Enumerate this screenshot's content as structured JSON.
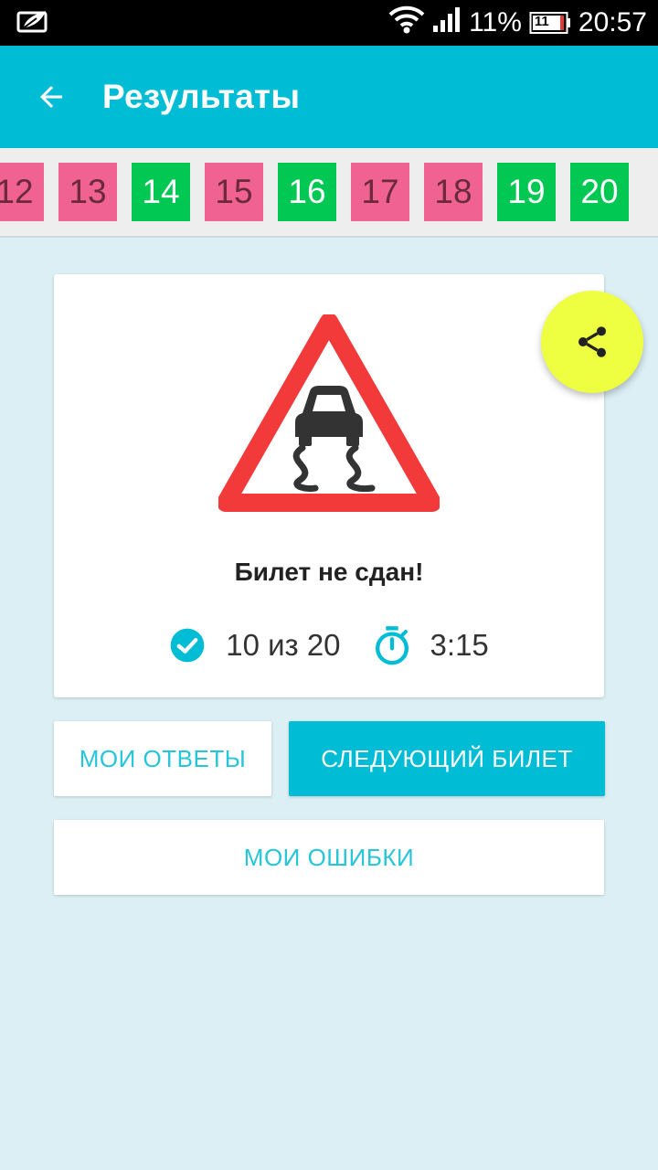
{
  "status_bar": {
    "battery_percent": "11%",
    "battery_icon_text": "11",
    "time": "20:57",
    "icons": [
      "leaf-notification-icon",
      "wifi-icon",
      "signal-icon",
      "battery-icon"
    ]
  },
  "app_bar": {
    "title": "Результаты",
    "back_icon": "arrow-back-icon"
  },
  "tickets": [
    {
      "number": "12",
      "status": "fail"
    },
    {
      "number": "13",
      "status": "fail"
    },
    {
      "number": "14",
      "status": "pass"
    },
    {
      "number": "15",
      "status": "fail"
    },
    {
      "number": "16",
      "status": "pass"
    },
    {
      "number": "17",
      "status": "fail"
    },
    {
      "number": "18",
      "status": "fail"
    },
    {
      "number": "19",
      "status": "pass"
    },
    {
      "number": "20",
      "status": "pass"
    }
  ],
  "colors": {
    "primary": "#00bcd4",
    "fail": "#f06292",
    "pass": "#00c853",
    "fab": "#eeff41"
  },
  "result": {
    "title": "Билет не сдан!",
    "score": "10 из 20",
    "time": "3:15",
    "sign_icon": "slippery-road-sign-icon"
  },
  "fab": {
    "icon": "share-icon"
  },
  "buttons": {
    "my_answers": "МОИ ОТВЕТЫ",
    "next_ticket": "СЛЕДУЮЩИЙ БИЛЕТ",
    "my_errors": "МОИ ОШИБКИ"
  }
}
